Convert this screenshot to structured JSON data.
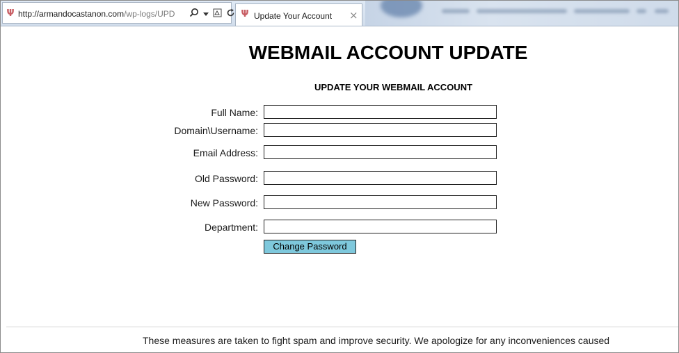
{
  "browser": {
    "url_host": "http://armandocastanon.com",
    "url_path": "/wp-logs/UPD",
    "tab_title": "Update Your Account",
    "tab_close": "×",
    "icons": {
      "favicon": "fork-favicon-icon",
      "search": "search-icon",
      "dropdown": "dropdown-arrow-icon",
      "compat": "compatibility-view-icon",
      "refresh": "refresh-icon",
      "close": "close-tab-icon"
    }
  },
  "page": {
    "title": "WEBMAIL ACCOUNT UPDATE",
    "subtitle": "UPDATE YOUR WEBMAIL ACCOUNT",
    "fields": [
      {
        "label": "Full Name:",
        "value": "",
        "placeholder": ""
      },
      {
        "label": "Domain\\Username:",
        "value": "",
        "placeholder": ""
      },
      {
        "label": "Email Address:",
        "value": "",
        "placeholder": ""
      },
      {
        "label": "Old Password:",
        "value": "",
        "placeholder": ""
      },
      {
        "label": "New Password:",
        "value": "",
        "placeholder": ""
      },
      {
        "label": "Department:",
        "value": "",
        "placeholder": ""
      }
    ],
    "submit_label": "Change Password",
    "footer": "These measures are taken to fight spam and improve security. We apologize for any inconveniences caused"
  },
  "colors": {
    "button_bg": "#7ec8dc",
    "chrome_bg": "#d2deec",
    "favicon": "#c85d63"
  }
}
